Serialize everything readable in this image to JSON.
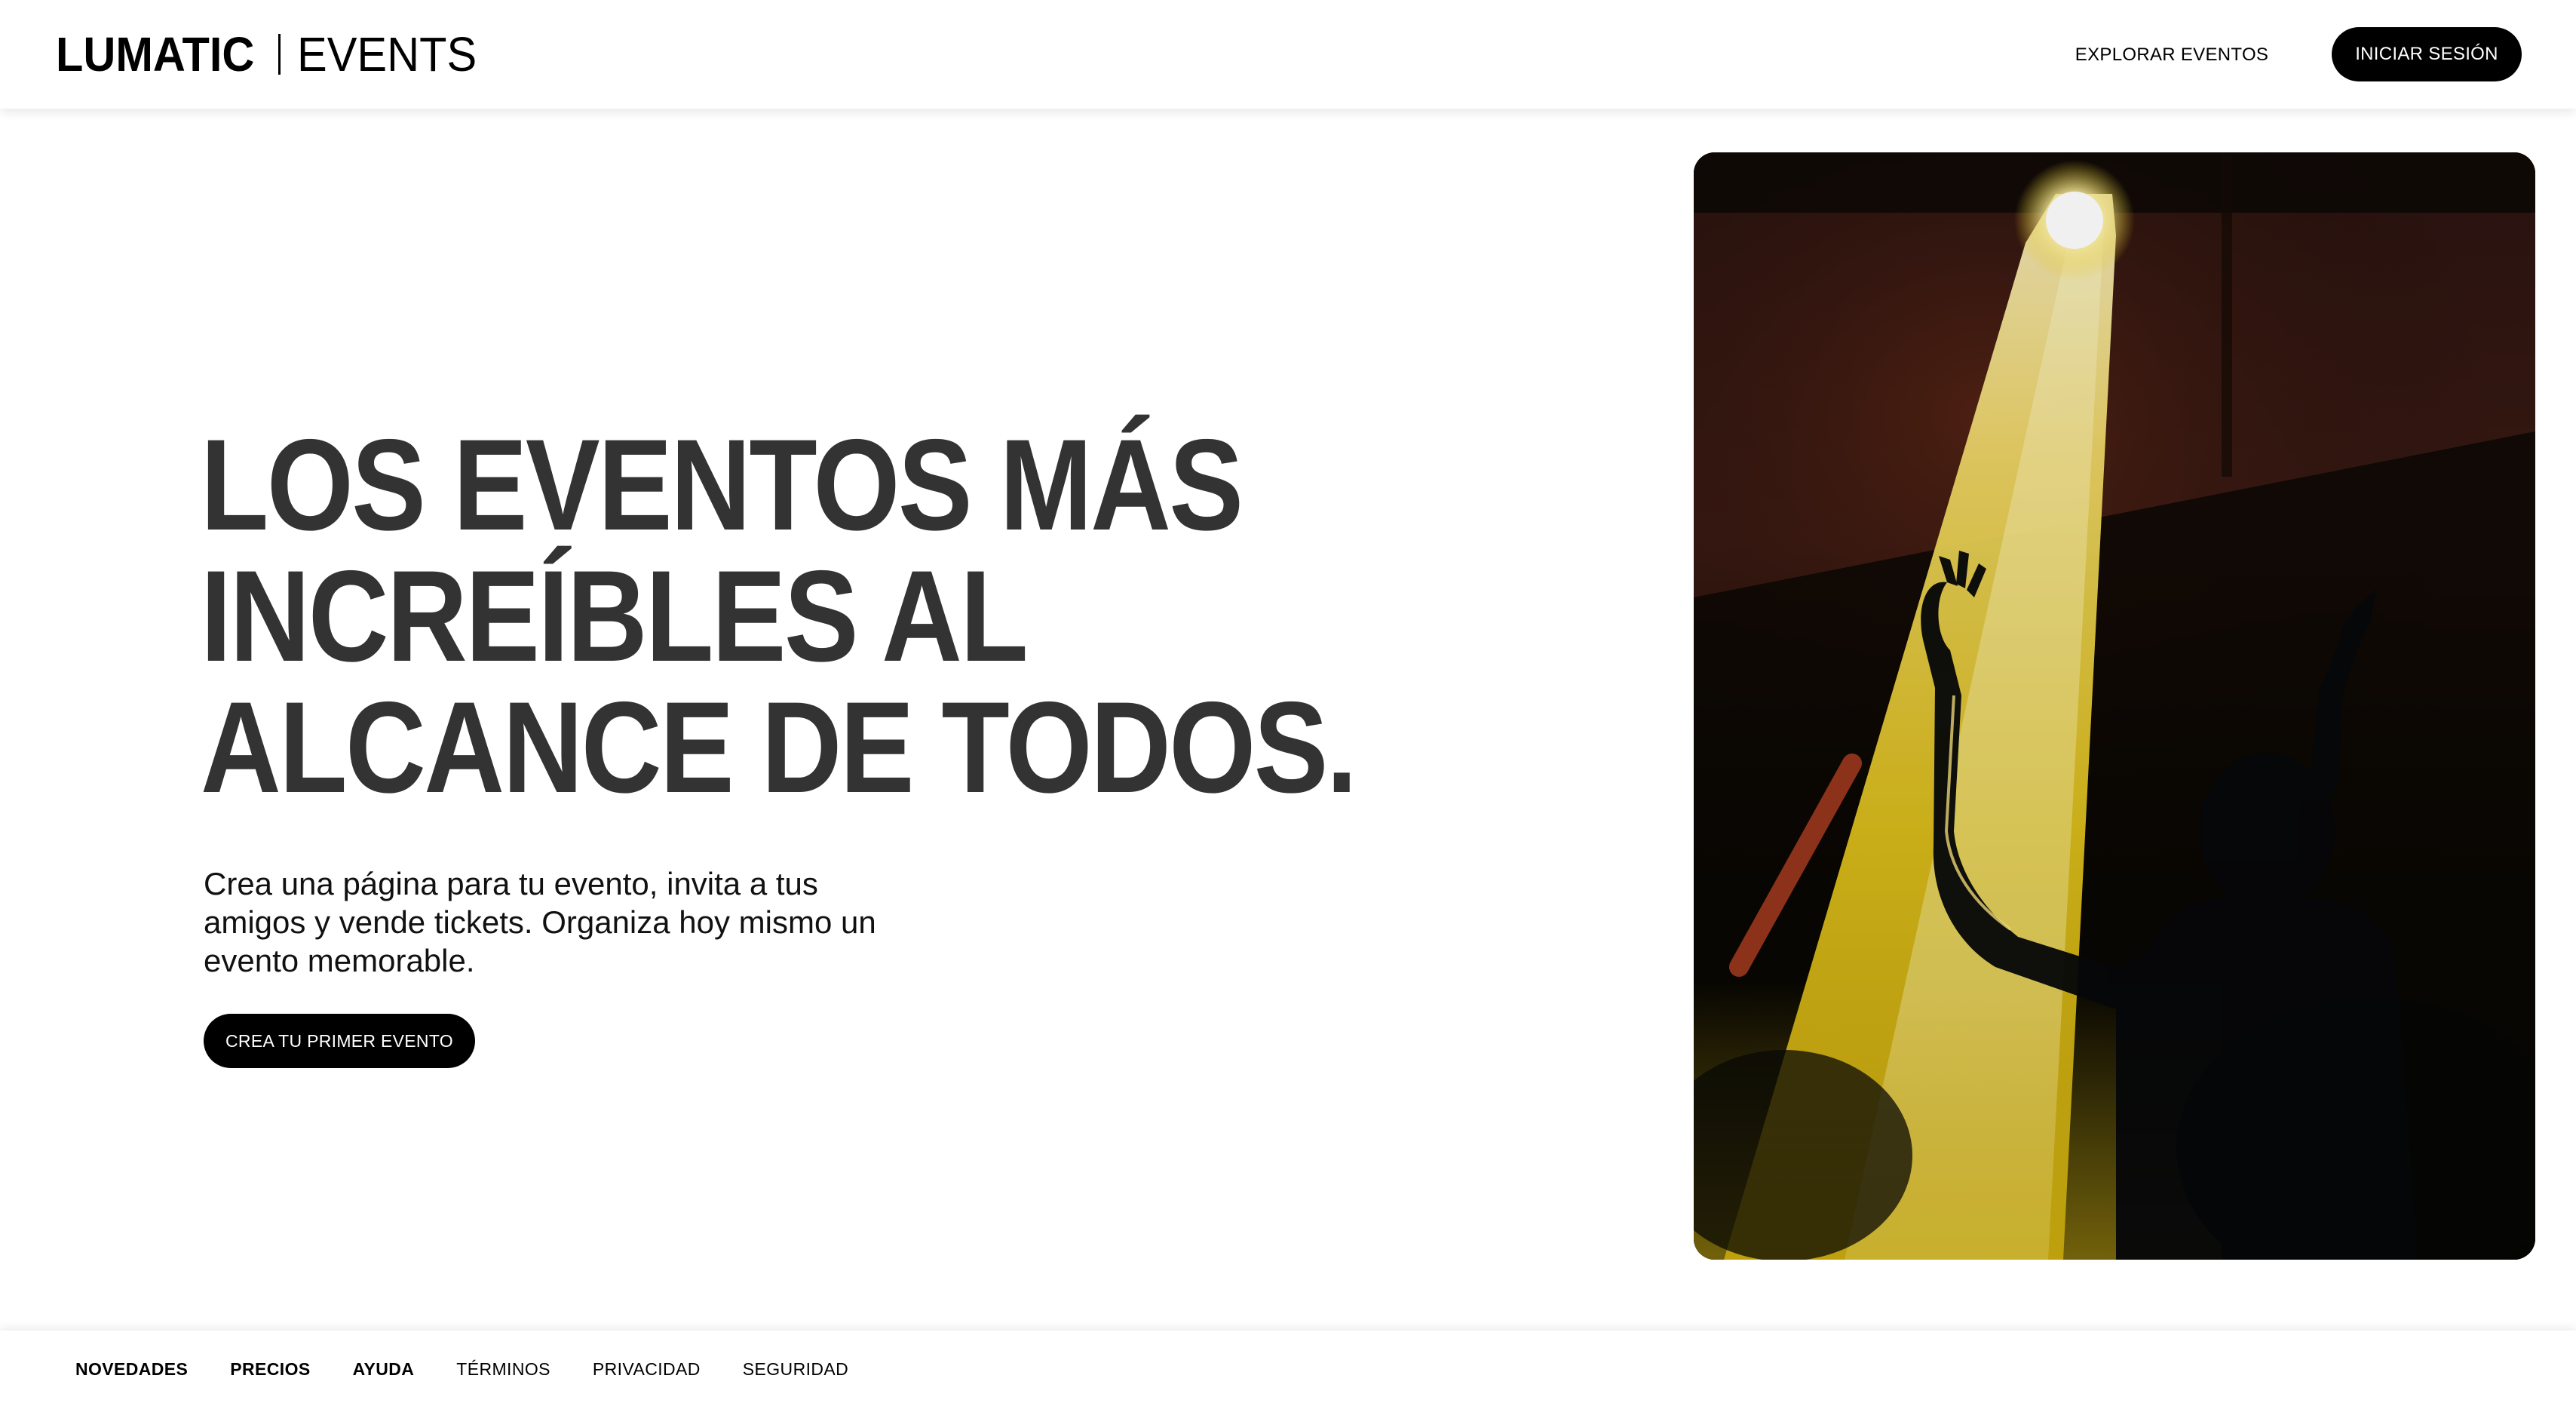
{
  "brand": {
    "name": "LUMATIC",
    "product": "EVENTS"
  },
  "nav": {
    "explore_label": "EXPLORAR EVENTOS",
    "login_label": "INICIAR SESIÓN"
  },
  "hero": {
    "title_lines": [
      "LOS EVENTOS MÁS",
      "INCREÍBLES AL",
      "ALCANCE DE TODOS."
    ],
    "subtitle": "Crea una página para tu evento, invita a tus amigos y vende tickets. Organiza hoy mismo un evento memorable.",
    "cta_label": "CREA TU PRIMER EVENTO"
  },
  "footer": {
    "links": [
      {
        "label": "NOVEDADES",
        "bold": true
      },
      {
        "label": "PRECIOS",
        "bold": true
      },
      {
        "label": "AYUDA",
        "bold": true
      },
      {
        "label": "TÉRMINOS",
        "bold": false
      },
      {
        "label": "PRIVACIDAD",
        "bold": false
      },
      {
        "label": "SEGURIDAD",
        "bold": false
      }
    ]
  },
  "colors": {
    "accent": "#000000",
    "title": "#333333",
    "background": "#ffffff",
    "light_beam": "#f2d21e"
  }
}
